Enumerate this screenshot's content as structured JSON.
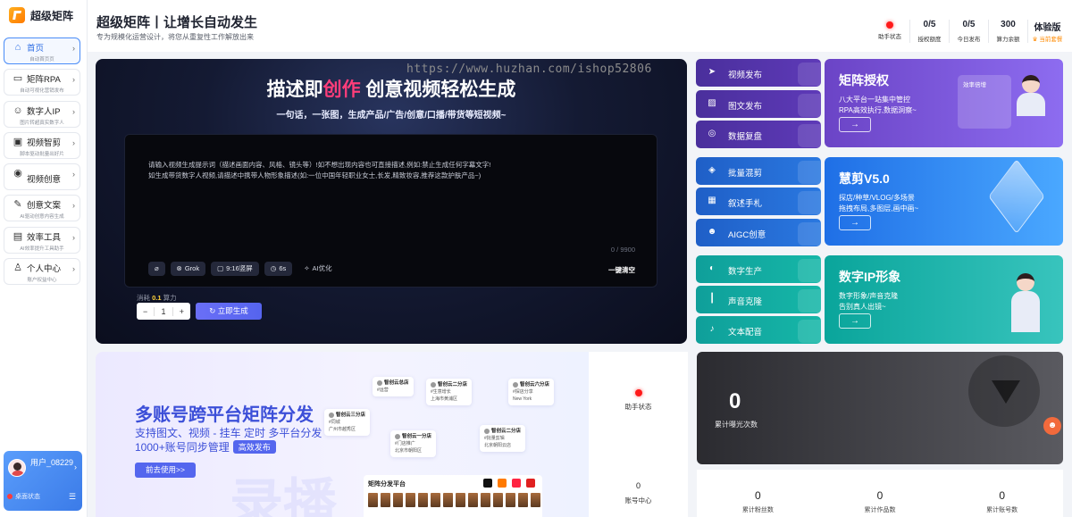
{
  "sidebar": {
    "logo": "超级矩阵",
    "items": [
      {
        "label": "首页",
        "sub": "自动首页页",
        "icon": "home-icon",
        "glyph": "⌂"
      },
      {
        "label": "矩阵RPA",
        "sub": "自动可视化营销发布",
        "icon": "rpa-icon",
        "glyph": "▭"
      },
      {
        "label": "数字人IP",
        "sub": "图片转超真实数字人",
        "icon": "robot-icon",
        "glyph": "☺"
      },
      {
        "label": "视频智剪",
        "sub": "脚本驱动批量出好片",
        "icon": "video-icon",
        "glyph": "▣"
      },
      {
        "label": "视频创意",
        "sub": "",
        "icon": "camera-icon",
        "glyph": "◉"
      },
      {
        "label": "创意文案",
        "sub": "AI驱动创意内容生成",
        "icon": "copywriting-icon",
        "glyph": "✎"
      },
      {
        "label": "效率工具",
        "sub": "AI效率提升工具助手",
        "icon": "toolbox-icon",
        "glyph": "▤"
      },
      {
        "label": "个人中心",
        "sub": "账户权益中心",
        "icon": "user-icon",
        "glyph": "♙"
      }
    ],
    "user": {
      "name": "用户_08229",
      "status": "桌面状态",
      "menu_icon": "list-icon"
    }
  },
  "header": {
    "title": "超级矩阵丨让增长自动发生",
    "subtitle": "专为规模化运营设计，将您从重复性工作解放出来",
    "stats": [
      {
        "value": "",
        "label": "助手状态",
        "indicator": "#ff1a1a"
      },
      {
        "value": "0/5",
        "label": "授权额度"
      },
      {
        "value": "0/5",
        "label": "今日发布"
      },
      {
        "value": "300",
        "label": "算力余额"
      },
      {
        "value": "体验版",
        "label": "当前套餐"
      }
    ]
  },
  "hero": {
    "title_pre": "描述即",
    "title_hl": "创作",
    "title_post": " 创意视频轻松生成",
    "subtitle": "一句话，一张图，生成产品/广告/创意/口播/带货等短视频~",
    "placeholder_line1": "请输入视频生成提示词（描述画面内容、风格、镜头等）!如不想出现内容也可直接描述,例如:禁止生成任何字幕文字!",
    "placeholder_line2": "如生成带货数字人视频,请描述中携带人物形象描述(如:一位中国年轻职业女士,长发,精致妆容,推荐这款护肤产品~)",
    "counter": "0 / 9900",
    "tools": [
      {
        "label": "",
        "icon": "attach-icon",
        "glyph": "⌀"
      },
      {
        "label": "Grok",
        "icon": "model-icon",
        "glyph": "⊗"
      },
      {
        "label": "9:16竖屏",
        "icon": "aspect-icon",
        "glyph": "▢"
      },
      {
        "label": "6s",
        "icon": "clock-icon",
        "glyph": "◷"
      }
    ],
    "ai_optimize": "AI优化",
    "clear": "一键清空",
    "cost_label": "消耗",
    "cost_value": "0.1",
    "cost_unit": "算力",
    "quantity": "1",
    "generate": "立即生成"
  },
  "watermark": "https://www.huzhan.com/ishop52806",
  "tiles": [
    {
      "label": "视频发布",
      "icon": "send-icon",
      "glyph": "➤"
    },
    {
      "label": "图文发布",
      "icon": "image-icon",
      "glyph": "▨"
    },
    {
      "label": "数据复盘",
      "icon": "data-icon",
      "glyph": "◎"
    },
    {
      "label": "批量混剪",
      "icon": "layers-icon",
      "glyph": "◈"
    },
    {
      "label": "叙述手札",
      "icon": "note-icon",
      "glyph": "▦"
    },
    {
      "label": "AIGC创意",
      "icon": "aigc-icon",
      "glyph": "☻"
    },
    {
      "label": "数字生产",
      "icon": "digital-icon",
      "glyph": "◐"
    },
    {
      "label": "声音克隆",
      "icon": "sound-icon",
      "glyph": "┃"
    },
    {
      "label": "文本配音",
      "icon": "mic-icon",
      "glyph": "♪"
    }
  ],
  "features": [
    {
      "title": "矩阵授权",
      "desc1": "八大平台一站集中管控",
      "desc2": "RPA高效执行,数据洞察~",
      "arrow": "→",
      "mini": "效率倍增"
    },
    {
      "title": "慧剪V5.0",
      "desc1": "探店/种草/VLOG/多场景",
      "desc2": "拖拽布局,多图层,画中画~",
      "arrow": "→"
    },
    {
      "title": "数字IP形象",
      "desc1": "数字形象/声音克隆",
      "desc2": "告别真人出镜~",
      "arrow": "→"
    }
  ],
  "banner": {
    "title": "多账号跨平台矩阵分发",
    "line1": "支持图文、视频 - 挂车 定时 多平台分发",
    "line2": "1000+账号同步管理",
    "badge": "高效发布",
    "button": "前去使用>>",
    "ghost": "录播",
    "matrix_title": "矩阵分发平台",
    "nodes": [
      {
        "name": "智创云二分店",
        "tag": "#生意增长",
        "loc": "上海市黄浦区"
      },
      {
        "name": "智创云六分店",
        "tag": "#探店分享",
        "loc": "New York"
      },
      {
        "name": "智创云三分店",
        "tag": "#同城",
        "loc": "广州市越秀区"
      },
      {
        "name": "智创云一分店",
        "tag": "#门店推广",
        "loc": "北京市朝阳区"
      },
      {
        "name": "智创云二分店",
        "tag": "#批量剪辑",
        "loc": "北京朝阳云店"
      },
      {
        "name": "智创云总店",
        "tag": "#运营",
        "loc": "杭州"
      }
    ]
  },
  "status_col": {
    "label": "助手状态",
    "account_value": "0",
    "account_label": "账号中心"
  },
  "exposure": {
    "value": "0",
    "label": "累计曝光次数"
  },
  "bottom_stats": [
    {
      "value": "0",
      "label": "累计粉丝数"
    },
    {
      "value": "0",
      "label": "累计作品数"
    },
    {
      "value": "0",
      "label": "累计账号数"
    }
  ]
}
